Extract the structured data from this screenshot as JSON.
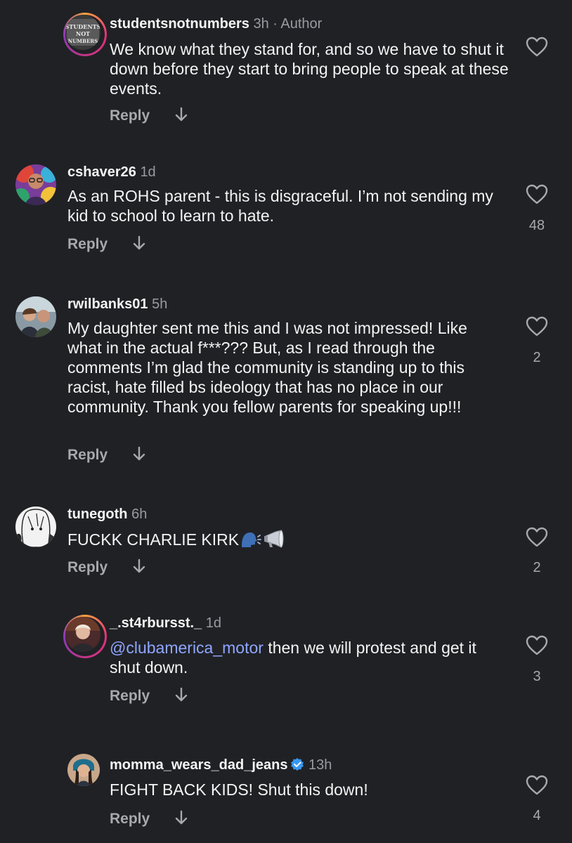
{
  "comments": [
    {
      "username": "studentsnotnumbers",
      "time": "3h",
      "author_tag": "· Author",
      "avatar_text": [
        "STUDENTS",
        "NOT",
        "NUMBERS"
      ],
      "text": "We know what they stand for, and so we have to shut it down before they start to bring people to speak at these events.",
      "reply_label": "Reply",
      "like_count": ""
    },
    {
      "username": "cshaver26",
      "time": "1d",
      "text": "As an ROHS parent - this is disgraceful. I’m not sending my kid to school to learn to hate.",
      "reply_label": "Reply",
      "like_count": "48"
    },
    {
      "username": "rwilbanks01",
      "time": "5h",
      "text": "My daughter sent me this and I was not impressed! Like what in the actual f***??? But, as I read through the comments I’m glad the community is standing up to this racist, hate filled bs ideology that has no place in our community. Thank you fellow parents for speaking up!!!",
      "reply_label": "Reply",
      "like_count": "2"
    },
    {
      "username": "tunegoth",
      "time": "6h",
      "text": "FUCKK CHARLIE KIRK",
      "emojis": [
        "speaking-head-icon",
        "megaphone-icon"
      ],
      "reply_label": "Reply",
      "like_count": "2"
    },
    {
      "username": "_.st4rbursst._",
      "time": "1d",
      "mention": "@clubamerica_motor",
      "text": " then we will protest and get it shut down.",
      "reply_label": "Reply",
      "like_count": "3"
    },
    {
      "username": "momma_wears_dad_jeans",
      "time": "13h",
      "verified": true,
      "text": "FIGHT BACK KIDS! Shut this down!",
      "reply_label": "Reply",
      "like_count": "4"
    }
  ],
  "colors": {
    "background": "#202125",
    "text": "#f4f4f4",
    "muted": "#9a9aa0",
    "mention": "#8fa6ff",
    "verified": "#3897f0",
    "story_ring": [
      "#f9a33c",
      "#e3317a",
      "#8a3ab9"
    ]
  }
}
